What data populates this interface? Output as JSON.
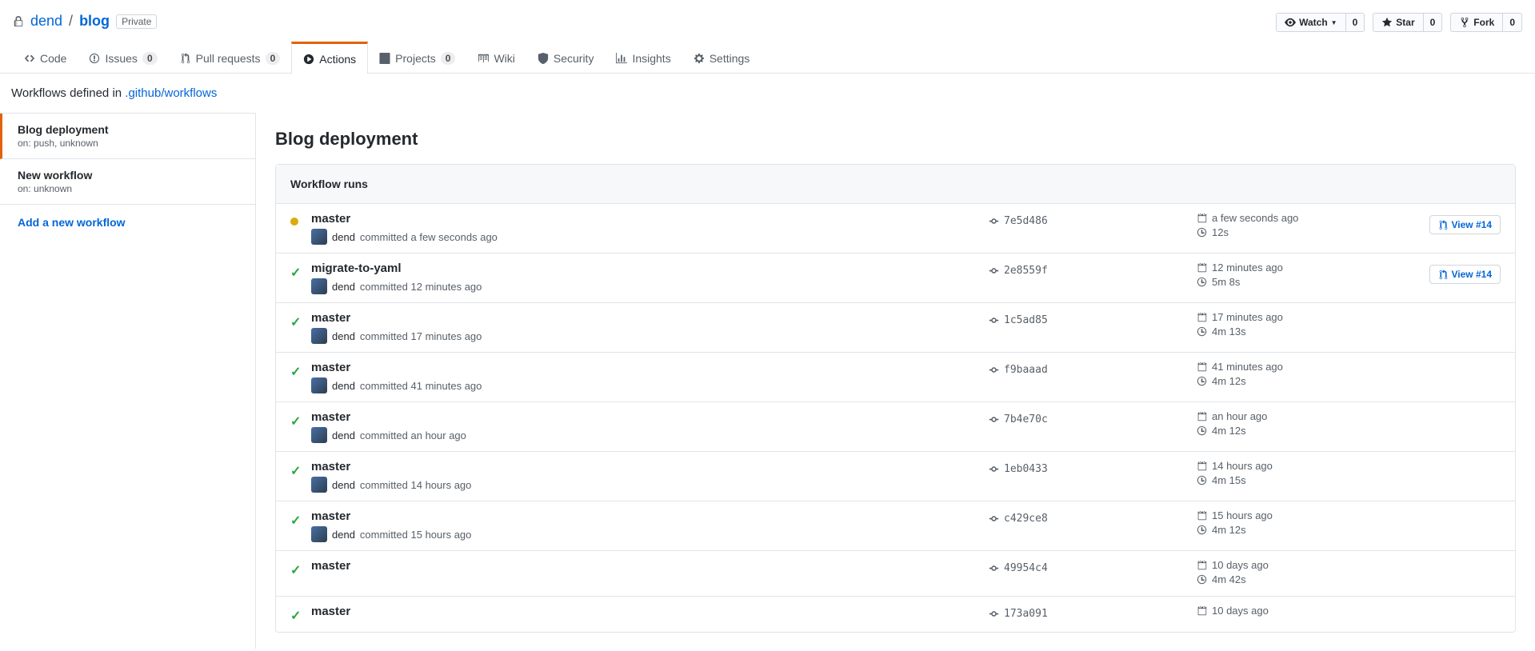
{
  "repo": {
    "owner": "dend",
    "name": "blog",
    "visibility": "Private"
  },
  "actions": {
    "watch": {
      "label": "Watch",
      "count": "0"
    },
    "star": {
      "label": "Star",
      "count": "0"
    },
    "fork": {
      "label": "Fork",
      "count": "0"
    }
  },
  "tabs": {
    "code": "Code",
    "issues": {
      "label": "Issues",
      "count": "0"
    },
    "pulls": {
      "label": "Pull requests",
      "count": "0"
    },
    "actions": "Actions",
    "projects": {
      "label": "Projects",
      "count": "0"
    },
    "wiki": "Wiki",
    "security": "Security",
    "insights": "Insights",
    "settings": "Settings"
  },
  "subhead": {
    "prefix": "Workflows defined in ",
    "link": ".github/workflows"
  },
  "sidebar": {
    "workflows": [
      {
        "name": "Blog deployment",
        "meta": "on: push, unknown",
        "active": true
      },
      {
        "name": "New workflow",
        "meta": "on: unknown",
        "active": false
      }
    ],
    "add": "Add a new workflow"
  },
  "content": {
    "title": "Blog deployment",
    "runs_header": "Workflow runs",
    "view_label": "View #14",
    "runs": [
      {
        "status": "pending",
        "branch": "master",
        "author": "dend",
        "committed": "committed a few seconds ago",
        "hash": "7e5d486",
        "calendar": "a few seconds ago",
        "duration": "12s",
        "view": true,
        "show_meta": true
      },
      {
        "status": "success",
        "branch": "migrate-to-yaml",
        "author": "dend",
        "committed": "committed 12 minutes ago",
        "hash": "2e8559f",
        "calendar": "12 minutes ago",
        "duration": "5m 8s",
        "view": true,
        "show_meta": true
      },
      {
        "status": "success",
        "branch": "master",
        "author": "dend",
        "committed": "committed 17 minutes ago",
        "hash": "1c5ad85",
        "calendar": "17 minutes ago",
        "duration": "4m 13s",
        "view": false,
        "show_meta": true
      },
      {
        "status": "success",
        "branch": "master",
        "author": "dend",
        "committed": "committed 41 minutes ago",
        "hash": "f9baaad",
        "calendar": "41 minutes ago",
        "duration": "4m 12s",
        "view": false,
        "show_meta": true
      },
      {
        "status": "success",
        "branch": "master",
        "author": "dend",
        "committed": "committed an hour ago",
        "hash": "7b4e70c",
        "calendar": "an hour ago",
        "duration": "4m 12s",
        "view": false,
        "show_meta": true
      },
      {
        "status": "success",
        "branch": "master",
        "author": "dend",
        "committed": "committed 14 hours ago",
        "hash": "1eb0433",
        "calendar": "14 hours ago",
        "duration": "4m 15s",
        "view": false,
        "show_meta": true
      },
      {
        "status": "success",
        "branch": "master",
        "author": "dend",
        "committed": "committed 15 hours ago",
        "hash": "c429ce8",
        "calendar": "15 hours ago",
        "duration": "4m 12s",
        "view": false,
        "show_meta": true
      },
      {
        "status": "success",
        "branch": "master",
        "author": "",
        "committed": "",
        "hash": "49954c4",
        "calendar": "10 days ago",
        "duration": "4m 42s",
        "view": false,
        "show_meta": false
      },
      {
        "status": "success",
        "branch": "master",
        "author": "",
        "committed": "",
        "hash": "173a091",
        "calendar": "10 days ago",
        "duration": "",
        "view": false,
        "show_meta": false
      }
    ]
  }
}
